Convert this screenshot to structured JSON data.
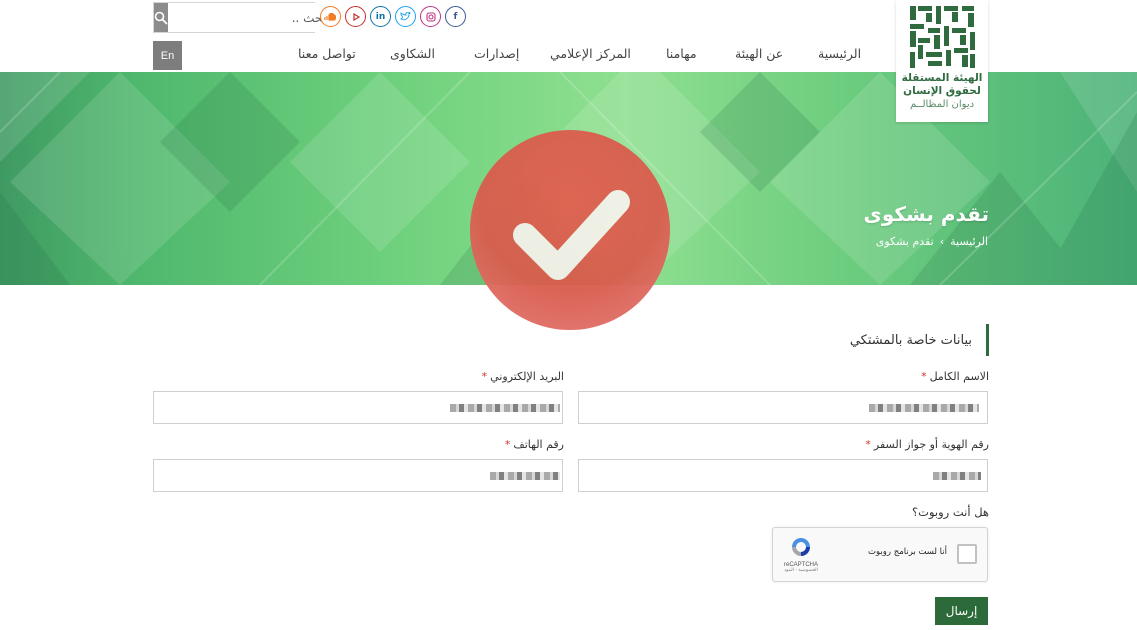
{
  "header": {
    "search_placeholder": "بحث ..",
    "lang_button": "En",
    "socials": [
      {
        "icon": "soundcloud-icon",
        "color": "#f47c20"
      },
      {
        "icon": "youtube-icon",
        "color": "#c4302b"
      },
      {
        "icon": "linkedin-icon",
        "color": "#0e76a8"
      },
      {
        "icon": "twitter-icon",
        "color": "#1da1f2"
      },
      {
        "icon": "instagram-icon",
        "color": "#c13584"
      },
      {
        "icon": "facebook-icon",
        "color": "#3b5998"
      }
    ],
    "nav": {
      "home": "الرئيسية",
      "about": "عن الهيئة",
      "tasks": "مهامنا",
      "media": "المركز الإعلامي",
      "publications": "إصدارات",
      "complaints": "الشكاوى",
      "contact": "تواصل معنا"
    },
    "logo": {
      "line1": "الهيئة المستقلة",
      "line2": "لحقوق الإنسان",
      "line3": "ديوان المظالــم"
    }
  },
  "banner": {
    "title": "تقدم بشكوى",
    "breadcrumb_home": "الرئيسية",
    "breadcrumb_sep": "›",
    "breadcrumb_current": "تقدم بشكوى"
  },
  "form": {
    "section_title": "بيانات خاصة بالمشتكي",
    "full_name_label": "الاسم الكامل",
    "email_label": "البريد الإلكتروني",
    "id_label": "رقم الهوية أو جواز السفر",
    "phone_label": "رقم الهاتف",
    "required_mark": "*",
    "robot_question": "هل أنت روبوت؟",
    "captcha_text": "أنا لست برنامج روبوت",
    "captcha_brand": "reCAPTCHA",
    "captcha_terms": "الخصوصية - البنود",
    "submit": "إرسال"
  },
  "overlay": {
    "success_color": "#d95c4d"
  }
}
